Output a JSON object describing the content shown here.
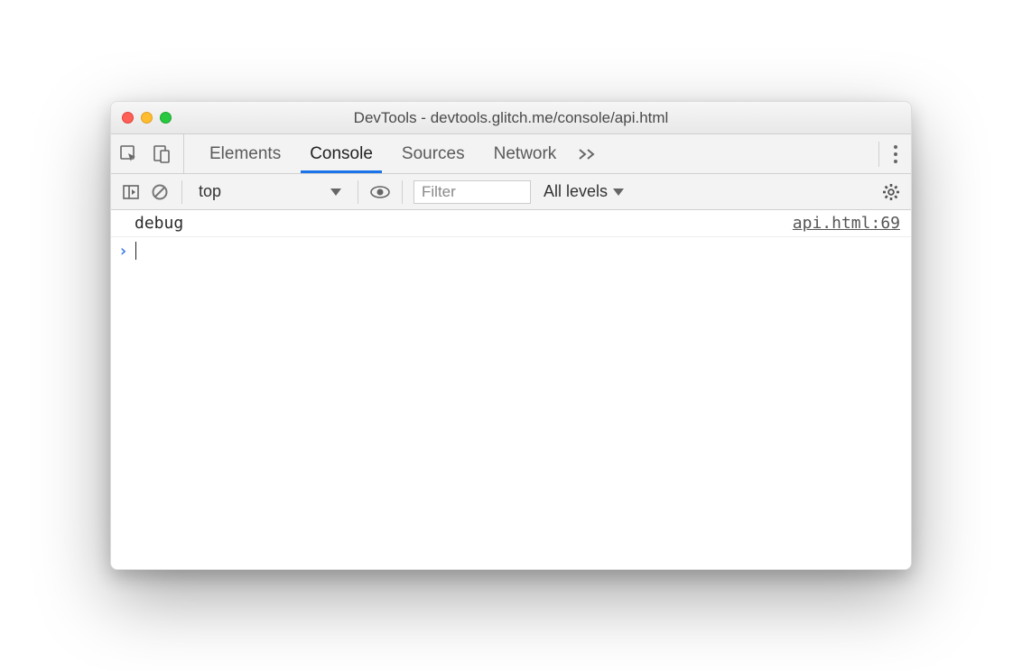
{
  "window": {
    "title": "DevTools - devtools.glitch.me/console/api.html"
  },
  "tabs": {
    "items": [
      "Elements",
      "Console",
      "Sources",
      "Network"
    ],
    "active": "Console"
  },
  "toolbar": {
    "context": "top",
    "filter_placeholder": "Filter",
    "filter_value": "",
    "level_label": "All levels"
  },
  "console": {
    "logs": [
      {
        "message": "debug",
        "source": "api.html:69"
      }
    ]
  }
}
